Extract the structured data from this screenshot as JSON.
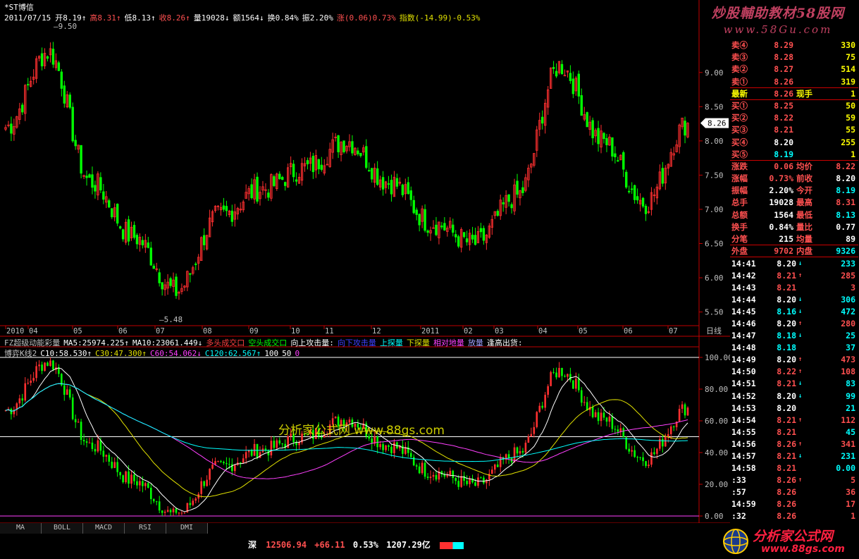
{
  "title": "*ST博信",
  "info": {
    "date": "2011/07/15",
    "items": [
      {
        "t": "开8.19↑",
        "c": "#ffffff"
      },
      {
        "t": "高8.31↑",
        "c": "#ff5050"
      },
      {
        "t": "低8.13↑",
        "c": "#ffffff"
      },
      {
        "t": "收8.26↑",
        "c": "#ff5050"
      },
      {
        "t": "量19028↓",
        "c": "#ffffff"
      },
      {
        "t": "额1564↓",
        "c": "#ffffff"
      },
      {
        "t": "换0.84%",
        "c": "#ffffff"
      },
      {
        "t": "振2.20%",
        "c": "#ffffff"
      },
      {
        "t": "涨(0.06)0.73%",
        "c": "#ff5050"
      },
      {
        "t": "指数(-14.99)-0.53%",
        "c": "#e0e000"
      }
    ]
  },
  "watermark_top": {
    "line1": "炒股輔助教材58股网",
    "line2": "www.58Gu.com"
  },
  "main_chart": {
    "ylim": [
      5.3,
      9.75
    ],
    "price_ticks": [
      "9.00",
      "8.50",
      "8.00",
      "7.50",
      "7.00",
      "6.50",
      "6.00",
      "5.50"
    ],
    "price_tick_values": [
      9.0,
      8.5,
      8.0,
      7.5,
      7.0,
      6.5,
      6.0,
      5.5
    ],
    "high_label": "9.50",
    "low_label": "5.48",
    "current_label": "8.26",
    "date_labels": [
      "2010",
      "04",
      "05",
      "06",
      "07",
      "08",
      "09",
      "10",
      "11",
      "12",
      "2011",
      "02",
      "03",
      "04",
      "05",
      "06",
      "07"
    ],
    "period": "日线"
  },
  "chart_data": {
    "type": "line",
    "title": "*ST博信",
    "ylabel": "",
    "x": [
      "2010-03",
      "2010-04",
      "2010-05",
      "2010-06",
      "2010-07",
      "2010-08",
      "2010-09",
      "2010-10",
      "2010-11",
      "2010-12",
      "2011-01",
      "2011-02",
      "2011-03",
      "2011-04",
      "2011-05",
      "2011-06",
      "2011-07"
    ],
    "series": [
      {
        "name": "",
        "values": [
          8.2,
          9.3,
          7.4,
          6.6,
          5.8,
          6.9,
          7.3,
          7.6,
          8.0,
          7.4,
          6.8,
          6.5,
          7.2,
          9.1,
          8.0,
          7.1,
          8.26
        ]
      }
    ],
    "ylim": [
      5.3,
      9.75
    ]
  },
  "indicator1": {
    "items": [
      {
        "t": "FZ超级动能彩量",
        "c": "#c0c0c0"
      },
      {
        "t": "MA5:25974.225↑",
        "c": "#ffffff"
      },
      {
        "t": "MA10:23061.449↓",
        "c": "#ffffff"
      },
      {
        "t": "多头成交口",
        "c": "#ff4040"
      },
      {
        "t": "空头成交口",
        "c": "#00ff00"
      },
      {
        "t": "向上攻击量:",
        "c": "#ffffff"
      },
      {
        "t": "向下攻击量",
        "c": "#4040ff"
      },
      {
        "t": "上探量",
        "c": "#00ffff"
      },
      {
        "t": "下探量",
        "c": "#e0e000"
      },
      {
        "t": "相对地量",
        "c": "#ff40ff"
      },
      {
        "t": "放量",
        "c": "#a0a0ff"
      },
      {
        "t": "逢高出货:",
        "c": "#ffffff"
      }
    ]
  },
  "indicator2": {
    "items": [
      {
        "t": "博弈K线2",
        "c": "#c0c0c0"
      },
      {
        "t": "C10:58.530↑",
        "c": "#ffffff"
      },
      {
        "t": "C30:47.300↑",
        "c": "#e0e000"
      },
      {
        "t": "C60:54.062↓",
        "c": "#ff40ff"
      },
      {
        "t": "C120:62.567↑",
        "c": "#00ffff"
      },
      {
        "t": "100",
        "c": "#ffffff"
      },
      {
        "t": "50",
        "c": "#ffffff"
      },
      {
        "t": "0",
        "c": "#ff40ff"
      }
    ],
    "ticks": [
      "100.00",
      "80.00",
      "60.00",
      "40.00",
      "20.00",
      "0.00"
    ]
  },
  "center_watermark": "分析家公式网 www.88gs.com",
  "quote": {
    "sell": [
      {
        "label": "卖④",
        "price": "8.29",
        "vol": "330"
      },
      {
        "label": "卖③",
        "price": "8.28",
        "vol": "75"
      },
      {
        "label": "卖②",
        "price": "8.27",
        "vol": "514"
      },
      {
        "label": "卖①",
        "price": "8.26",
        "vol": "319"
      }
    ],
    "latest": {
      "label": "最新",
      "price": "8.26",
      "l2": "现手",
      "v2": "1"
    },
    "buy": [
      {
        "label": "买①",
        "price": "8.25",
        "vol": "50",
        "pc": "#ff5050"
      },
      {
        "label": "买②",
        "price": "8.22",
        "vol": "59",
        "pc": "#ff5050"
      },
      {
        "label": "买③",
        "price": "8.21",
        "vol": "55",
        "pc": "#ff5050"
      },
      {
        "label": "买④",
        "price": "8.20",
        "vol": "255",
        "pc": "#ffffff"
      },
      {
        "label": "买⑤",
        "price": "8.19",
        "vol": "1",
        "pc": "#00ffff"
      }
    ],
    "stats": [
      {
        "l1": "涨跌",
        "v1": "0.06",
        "c1": "#ff5050",
        "l2": "均价",
        "v2": "8.22",
        "c2": "#ff5050"
      },
      {
        "l1": "涨幅",
        "v1": "0.73%",
        "c1": "#ff5050",
        "l2": "前收",
        "v2": "8.20",
        "c2": "#ffffff"
      },
      {
        "l1": "振幅",
        "v1": "2.20%",
        "c1": "#ffffff",
        "l2": "今开",
        "v2": "8.19",
        "c2": "#00ffff"
      },
      {
        "l1": "总手",
        "v1": "19028",
        "c1": "#ffffff",
        "l2": "最高",
        "v2": "8.31",
        "c2": "#ff5050"
      },
      {
        "l1": "总额",
        "v1": "1564",
        "c1": "#ffffff",
        "l2": "最低",
        "v2": "8.13",
        "c2": "#00ffff"
      },
      {
        "l1": "换手",
        "v1": "0.84%",
        "c1": "#ffffff",
        "l2": "量比",
        "v2": "0.77",
        "c2": "#ffffff"
      },
      {
        "l1": "分笔",
        "v1": "215",
        "c1": "#ffffff",
        "l2": "均量",
        "v2": "89",
        "c2": "#ffffff"
      }
    ],
    "outer": {
      "l1": "外盘",
      "v1": "9702",
      "l2": "内盘",
      "v2": "9326"
    }
  },
  "ticks_list": [
    {
      "time": "14:41",
      "price": "8.20",
      "arrow": "↓",
      "vol": "233",
      "pc": "#ffffff",
      "vc": "#00ffff"
    },
    {
      "time": "14:42",
      "price": "8.21",
      "arrow": "↑",
      "vol": "285",
      "pc": "#ff5050",
      "vc": "#ff5050"
    },
    {
      "time": "14:43",
      "price": "8.21",
      "arrow": "",
      "vol": "3",
      "pc": "#ff5050",
      "vc": "#ff5050"
    },
    {
      "time": "14:44",
      "price": "8.20",
      "arrow": "↓",
      "vol": "306",
      "pc": "#ffffff",
      "vc": "#00ffff"
    },
    {
      "time": "14:45",
      "price": "8.16",
      "arrow": "↓",
      "vol": "472",
      "pc": "#00ffff",
      "vc": "#00ffff"
    },
    {
      "time": "14:46",
      "price": "8.20",
      "arrow": "↑",
      "vol": "280",
      "pc": "#ffffff",
      "vc": "#ff5050"
    },
    {
      "time": "14:47",
      "price": "8.18",
      "arrow": "↓",
      "vol": "25",
      "pc": "#00ffff",
      "vc": "#00ffff"
    },
    {
      "time": "14:48",
      "price": "8.18",
      "arrow": "",
      "vol": "37",
      "pc": "#00ffff",
      "vc": "#00ffff"
    },
    {
      "time": "14:49",
      "price": "8.20",
      "arrow": "↑",
      "vol": "473",
      "pc": "#ffffff",
      "vc": "#ff5050"
    },
    {
      "time": "14:50",
      "price": "8.22",
      "arrow": "↑",
      "vol": "108",
      "pc": "#ff5050",
      "vc": "#ff5050"
    },
    {
      "time": "14:51",
      "price": "8.21",
      "arrow": "↓",
      "vol": "83",
      "pc": "#ff5050",
      "vc": "#00ffff"
    },
    {
      "time": "14:52",
      "price": "8.20",
      "arrow": "↓",
      "vol": "99",
      "pc": "#ffffff",
      "vc": "#00ffff"
    },
    {
      "time": "14:53",
      "price": "8.20",
      "arrow": "",
      "vol": "21",
      "pc": "#ffffff",
      "vc": "#00ffff"
    },
    {
      "time": "14:54",
      "price": "8.21",
      "arrow": "↑",
      "vol": "112",
      "pc": "#ff5050",
      "vc": "#ff5050"
    },
    {
      "time": "14:55",
      "price": "8.21",
      "arrow": "",
      "vol": "45",
      "pc": "#ff5050",
      "vc": "#00ffff"
    },
    {
      "time": "14:56",
      "price": "8.26",
      "arrow": "↑",
      "vol": "341",
      "pc": "#ff5050",
      "vc": "#ff5050"
    },
    {
      "time": "14:57",
      "price": "8.21",
      "arrow": "↓",
      "vol": "231",
      "pc": "#ff5050",
      "vc": "#00ffff"
    },
    {
      "time": "14:58",
      "price": "8.21",
      "arrow": "",
      "vol": "0.00",
      "pc": "#ff5050",
      "vc": "#00ffff"
    },
    {
      "time": ":33",
      "price": "8.26",
      "arrow": "↑",
      "vol": "5",
      "pc": "#ff5050",
      "vc": "#ff5050"
    },
    {
      "time": ":57",
      "price": "8.26",
      "arrow": "",
      "vol": "36",
      "pc": "#ff5050",
      "vc": "#ff5050"
    },
    {
      "time": "14:59",
      "price": "8.26",
      "arrow": "",
      "vol": "17",
      "pc": "#ff5050",
      "vc": "#ff5050"
    },
    {
      "time": ":32",
      "price": "8.26",
      "arrow": "",
      "vol": "1",
      "pc": "#ff5050",
      "vc": "#ff5050"
    }
  ],
  "bottom_tabs": [
    "MA",
    "BOLL",
    "MACD",
    "RSI",
    "DMI"
  ],
  "status": {
    "market": "深",
    "index": "12506.94",
    "change": "+66.11",
    "pct": "0.53%",
    "amount": "1207.29亿"
  },
  "logo_br": {
    "line1": "分析家公式网",
    "line2": "www.88gs.com"
  },
  "colors": {
    "up": "#ff3030",
    "down": "#00ff00",
    "axis": "#c00000"
  }
}
